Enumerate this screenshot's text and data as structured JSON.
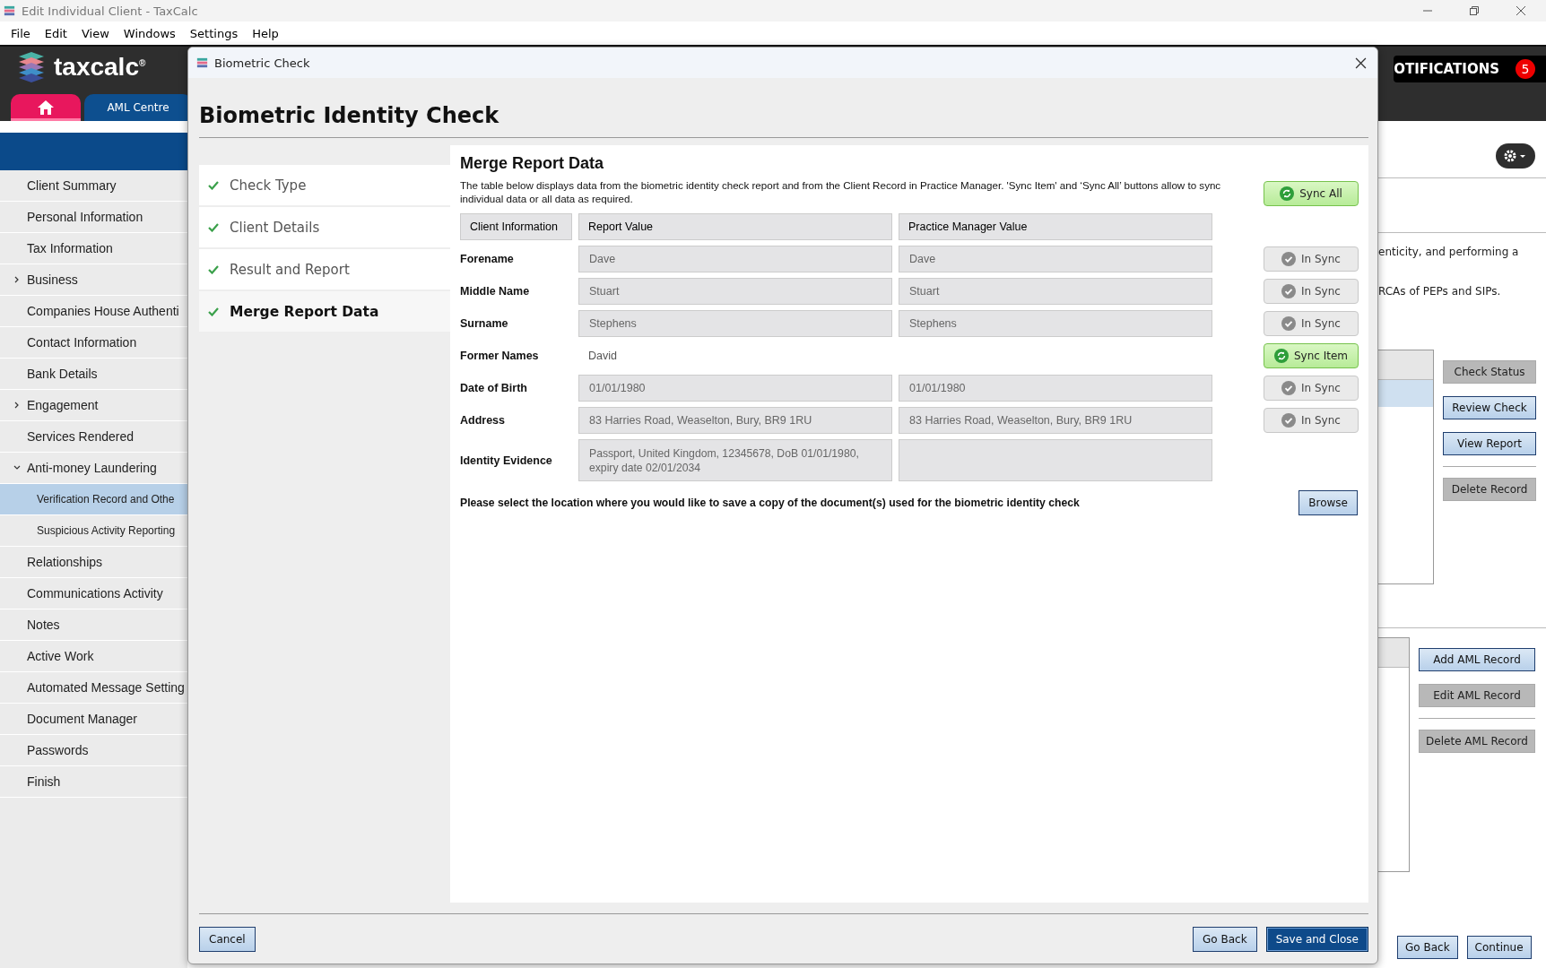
{
  "window": {
    "title": "Edit Individual Client - TaxCalc"
  },
  "menu": [
    "File",
    "Edit",
    "View",
    "Windows",
    "Settings",
    "Help"
  ],
  "header": {
    "logo": "taxcalc",
    "logo_mark": "®",
    "notifications_label": "OTIFICATIONS",
    "notifications_count": "5"
  },
  "tabs": [
    {
      "kind": "home",
      "selected": true
    },
    {
      "kind": "text",
      "label": "AML Centre",
      "selected": false
    }
  ],
  "sidebar": {
    "items": [
      {
        "label": "Client Summary",
        "selected": false
      },
      {
        "label": "Personal Information",
        "selected": false
      },
      {
        "label": "Tax Information",
        "selected": false
      },
      {
        "label": "Business",
        "selected": false,
        "expanded": false
      },
      {
        "label": "Companies House Authenti",
        "selected": false
      },
      {
        "label": "Contact Information",
        "selected": false
      },
      {
        "label": "Bank Details",
        "selected": false
      },
      {
        "label": "Engagement",
        "selected": false,
        "expanded": false
      },
      {
        "label": "Services Rendered",
        "selected": false
      },
      {
        "label": "Anti-money Laundering",
        "selected": false,
        "expanded": true,
        "children": [
          {
            "label": "Verification Record and Othe",
            "selected": true
          },
          {
            "label": "Suspicious Activity Reporting",
            "selected": false
          }
        ]
      },
      {
        "label": "Relationships",
        "selected": false
      },
      {
        "label": "Communications Activity",
        "selected": false
      },
      {
        "label": "Notes",
        "selected": false
      },
      {
        "label": "Active Work",
        "selected": false
      },
      {
        "label": "Automated Message Setting",
        "selected": false
      },
      {
        "label": "Document Manager",
        "selected": false
      },
      {
        "label": "Passwords",
        "selected": false
      },
      {
        "label": "Finish",
        "selected": false
      }
    ]
  },
  "background_panel": {
    "text_lines": [
      "enticity, and performing a",
      "RCAs of PEPs and SIPs."
    ],
    "check_buttons": [
      {
        "label": "Check Status",
        "disabled": true
      },
      {
        "label": "Review Check",
        "disabled": false
      },
      {
        "label": "View Report",
        "disabled": false
      },
      {
        "label": "Delete Record",
        "disabled": true
      }
    ],
    "record_buttons": [
      {
        "label": "Add AML Record",
        "disabled": false
      },
      {
        "label": "Edit AML Record",
        "disabled": true
      },
      {
        "label": "Delete AML Record",
        "disabled": true
      }
    ],
    "nav_buttons": [
      {
        "label": "Go Back",
        "disabled": false
      },
      {
        "label": "Continue",
        "disabled": false
      }
    ]
  },
  "dialog": {
    "title": "Biometric Check",
    "heading": "Biometric Identity Check",
    "steps": [
      {
        "label": "Check Type",
        "done": true,
        "selected": false
      },
      {
        "label": "Client Details",
        "done": true,
        "selected": false
      },
      {
        "label": "Result and Report",
        "done": true,
        "selected": false
      },
      {
        "label": "Merge Report Data",
        "done": true,
        "selected": true
      }
    ],
    "section_title": "Merge Report Data",
    "description": "The table below displays data from the biometric identity check report and from the Client Record in Practice Manager. 'Sync Item' and ‘Sync All’ buttons allow to sync individual data or all data as required.",
    "sync_all": {
      "label": "Sync All",
      "synced": false
    },
    "columns": [
      "Client Information",
      "Report Value",
      "Practice Manager Value"
    ],
    "rows": [
      {
        "label": "Forename",
        "boxed": true,
        "report": "Dave",
        "pm": "Dave",
        "sync": {
          "label": "In Sync",
          "synced": true
        }
      },
      {
        "label": "Middle Name",
        "boxed": true,
        "report": "Stuart",
        "pm": "Stuart",
        "sync": {
          "label": "In Sync",
          "synced": true
        }
      },
      {
        "label": "Surname",
        "boxed": true,
        "report": "Stephens",
        "pm": "Stephens",
        "sync": {
          "label": "In Sync",
          "synced": true
        }
      },
      {
        "label": "Former Names",
        "boxed": false,
        "report": "David",
        "sync": {
          "label": "Sync Item",
          "synced": false
        }
      },
      {
        "label": "Date of Birth",
        "boxed": true,
        "report": "01/01/1980",
        "pm": "01/01/1980",
        "sync": {
          "label": "In Sync",
          "synced": true
        }
      },
      {
        "label": "Address",
        "boxed": true,
        "report": "83 Harries Road, Weaselton, Bury, BR9 1RU",
        "pm": "83 Harries Road, Weaselton, Bury, BR9 1RU",
        "sync": {
          "label": "In Sync",
          "synced": true
        }
      },
      {
        "label": "Identity Evidence",
        "boxed": true,
        "tall": true,
        "report": "Passport, United Kingdom, 12345678, DoB 01/01/1980, expiry date 02/01/2034"
      }
    ],
    "save_prompt": "Please select the location where you would like to save a copy of the document(s) used for the biometric identity check",
    "browse": "Browse",
    "footer_left": [
      {
        "label": "Cancel",
        "default": false
      }
    ],
    "footer_right": [
      {
        "label": "Go Back",
        "default": false
      },
      {
        "label": "Save and Close",
        "default": true
      }
    ]
  }
}
